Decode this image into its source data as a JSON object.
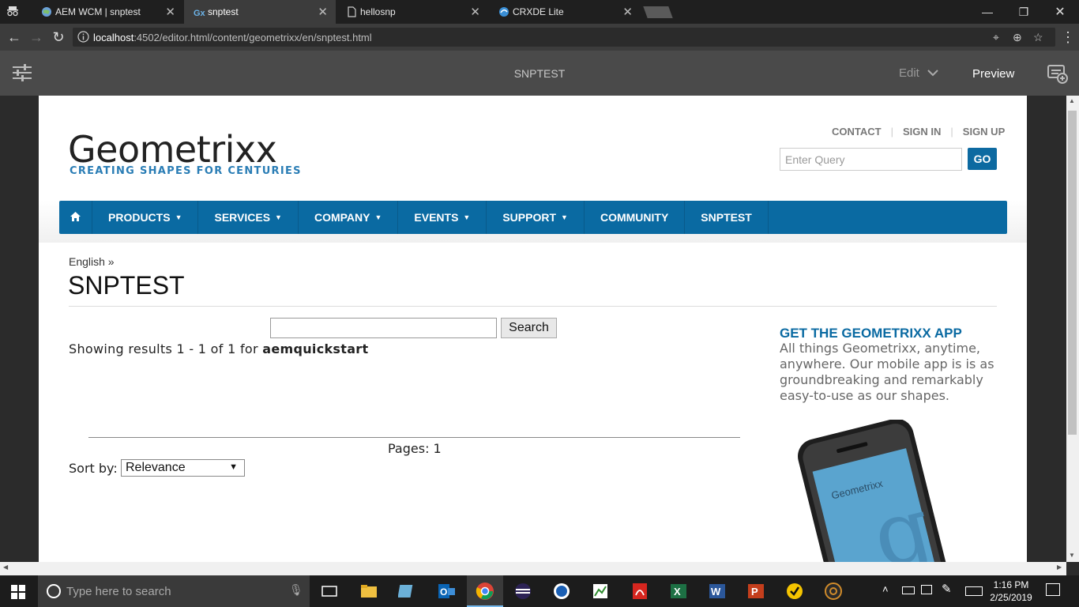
{
  "browser": {
    "tabs": [
      {
        "title": "AEM WCM | snptest"
      },
      {
        "title": "snptest"
      },
      {
        "title": "hellosnp"
      },
      {
        "title": "CRXDE Lite"
      }
    ],
    "url_host": "localhost",
    "url_rest": ":4502/editor.html/content/geometrixx/en/snptest.html"
  },
  "editor": {
    "page_title": "SNPTEST",
    "mode": "Edit",
    "preview": "Preview"
  },
  "site": {
    "logo_word": "Geometrixx",
    "logo_tagline": "CREATING SHAPES FOR CENTURIES",
    "top_links": [
      "CONTACT",
      "SIGN IN",
      "SIGN UP"
    ],
    "query_placeholder": "Enter Query",
    "go": "GO",
    "nav": [
      {
        "label": "PRODUCTS",
        "dd": "▼"
      },
      {
        "label": "SERVICES",
        "dd": "▼"
      },
      {
        "label": "COMPANY",
        "dd": "▼"
      },
      {
        "label": "EVENTS",
        "dd": "▼"
      },
      {
        "label": "SUPPORT",
        "dd": "▼"
      },
      {
        "label": "COMMUNITY",
        "dd": ""
      },
      {
        "label": "SNPTEST",
        "dd": ""
      }
    ],
    "breadcrumb": "English »",
    "title": "SNPTEST",
    "search_button": "Search",
    "results_prefix": "Showing results 1 - 1 of 1 for ",
    "results_term": "aemquickstart",
    "pages": "Pages: 1",
    "sort_label": "Sort by:",
    "sort_value": "Relevance",
    "app_heading": "GET THE GEOMETRIXX APP",
    "app_desc": "All things Geometrixx, anytime, anywhere. Our mobile app is is as groundbreaking and remarkably easy-to-use as our shapes.",
    "phone_logo": "Geometrixx"
  },
  "taskbar": {
    "search_placeholder": "Type here to search",
    "time": "1:16 PM",
    "date": "2/25/2019"
  }
}
